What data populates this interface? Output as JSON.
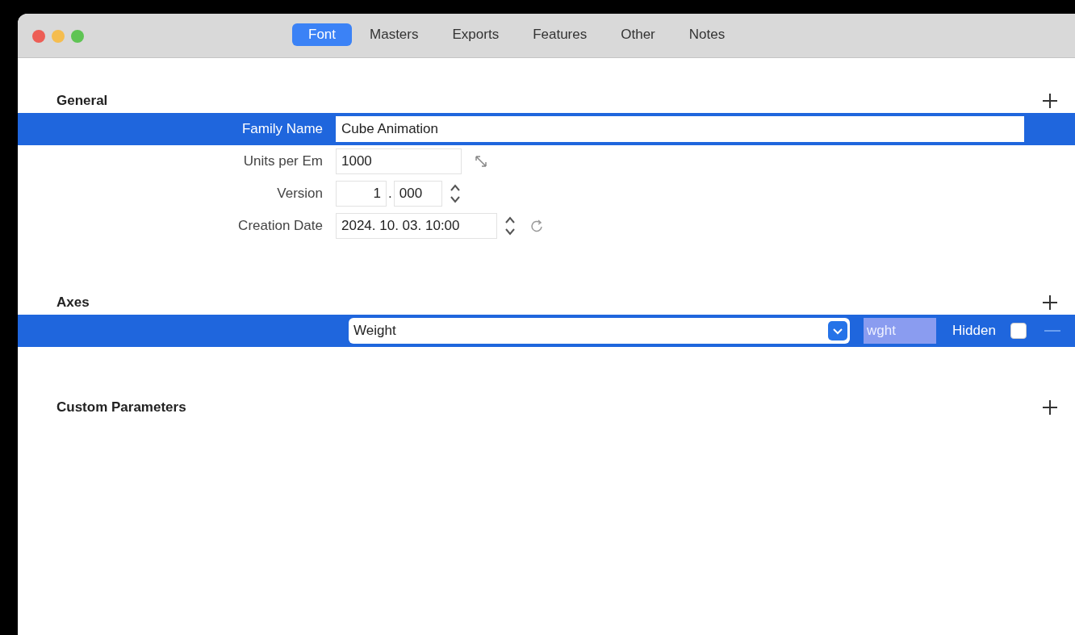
{
  "window": {
    "tabs": [
      {
        "label": "Font",
        "selected": true
      },
      {
        "label": "Masters",
        "selected": false
      },
      {
        "label": "Exports",
        "selected": false
      },
      {
        "label": "Features",
        "selected": false
      },
      {
        "label": "Other",
        "selected": false
      },
      {
        "label": "Notes",
        "selected": false
      }
    ]
  },
  "general": {
    "title": "General",
    "rows": [
      {
        "kind": "text",
        "label": "Family Name",
        "value": "Cube Animation",
        "selected": true
      },
      {
        "kind": "units",
        "label": "Units per Em",
        "value": "1000",
        "selected": false
      },
      {
        "kind": "version",
        "label": "Version",
        "major": "1",
        "separator": ".",
        "minor": "000",
        "selected": false
      },
      {
        "kind": "date",
        "label": "Creation Date",
        "value": "2024. 10. 03. 10:00",
        "selected": false
      }
    ]
  },
  "axes": {
    "title": "Axes",
    "rows": [
      {
        "name": "Weight",
        "tag_placeholder": "wght",
        "hidden_label": "Hidden",
        "hidden": false,
        "selected": true
      }
    ]
  },
  "custom_parameters": {
    "title": "Custom Parameters"
  }
}
